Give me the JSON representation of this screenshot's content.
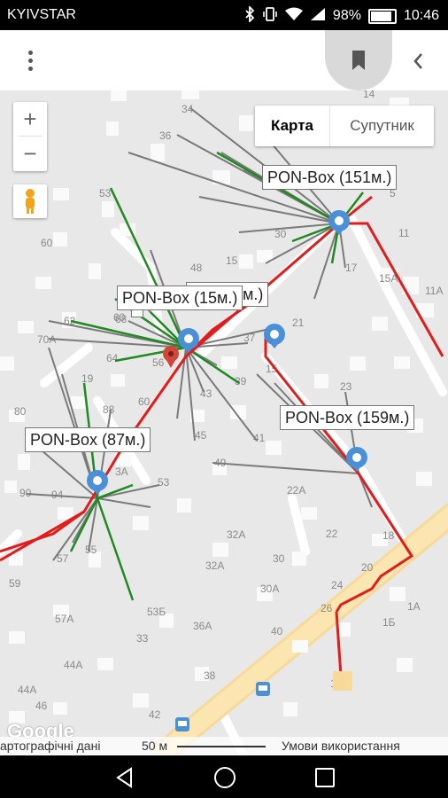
{
  "status_bar": {
    "carrier": "KYIVSTAR",
    "battery_percent": "98%",
    "battery_level": 0.98,
    "time": "10:46",
    "icons": [
      "bluetooth-icon",
      "vibrate-icon",
      "wifi-icon",
      "signal-icon",
      "battery-icon"
    ]
  },
  "toolbar": {
    "icons": [
      "more-vert-icon",
      "bookmark-icon",
      "chevron-left-icon"
    ]
  },
  "map": {
    "zoom_in": "+",
    "zoom_out": "−",
    "type_map": "Карта",
    "type_satellite": "Супутник",
    "pon_labels": {
      "box151": "PON-Box (151м.)",
      "box15": "PON-Box (15м.)",
      "m83": "(M) (83м.)",
      "box159": "PON-Box (159м.)",
      "box87": "PON-Box (87м.)"
    },
    "attribution": {
      "data": "артографічні дані",
      "scale": "50 м",
      "terms": "Умови використання",
      "logo": "Google"
    },
    "house_numbers": [
      {
        "t": "34"
      },
      {
        "t": "36"
      },
      {
        "t": "14"
      },
      {
        "t": "5"
      },
      {
        "t": "53"
      },
      {
        "t": "60"
      },
      {
        "t": "30"
      },
      {
        "t": "11"
      },
      {
        "t": "15"
      },
      {
        "t": "17"
      },
      {
        "t": "15А"
      },
      {
        "t": "11А"
      },
      {
        "t": "48"
      },
      {
        "t": "68"
      },
      {
        "t": "60"
      },
      {
        "t": "21"
      },
      {
        "t": "37"
      },
      {
        "t": "15"
      },
      {
        "t": "70А"
      },
      {
        "t": "64"
      },
      {
        "t": "62"
      },
      {
        "t": "56"
      },
      {
        "t": "39"
      },
      {
        "t": "43"
      },
      {
        "t": "23"
      },
      {
        "t": "80"
      },
      {
        "t": "88"
      },
      {
        "t": "19"
      },
      {
        "t": "45"
      },
      {
        "t": "41"
      },
      {
        "t": "60"
      },
      {
        "t": "3А"
      },
      {
        "t": "49"
      },
      {
        "t": "53"
      },
      {
        "t": "90"
      },
      {
        "t": "94"
      },
      {
        "t": "22А"
      },
      {
        "t": "22"
      },
      {
        "t": "57"
      },
      {
        "t": "55"
      },
      {
        "t": "32А"
      },
      {
        "t": "30"
      },
      {
        "t": "18"
      },
      {
        "t": "20"
      },
      {
        "t": "59"
      },
      {
        "t": "32А"
      },
      {
        "t": "30А"
      },
      {
        "t": "24"
      },
      {
        "t": "1А"
      },
      {
        "t": "57А"
      },
      {
        "t": "53Б"
      },
      {
        "t": "36А"
      },
      {
        "t": "26"
      },
      {
        "t": "1Б"
      },
      {
        "t": "44А"
      },
      {
        "t": "40"
      },
      {
        "t": "33"
      },
      {
        "t": "1В"
      },
      {
        "t": "44А"
      },
      {
        "t": "46"
      },
      {
        "t": "42"
      },
      {
        "t": "38"
      }
    ]
  }
}
